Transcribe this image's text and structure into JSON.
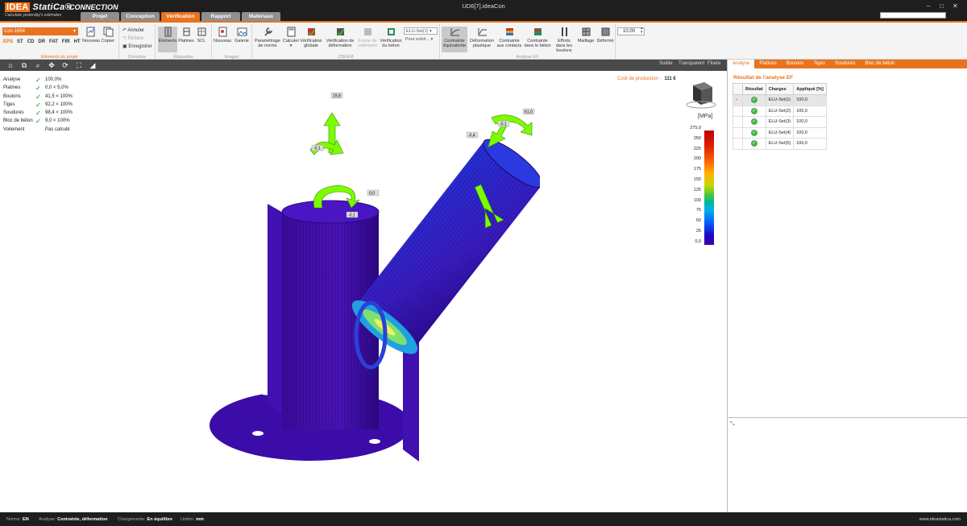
{
  "titlebar": {
    "logo_prefix": "IDEA",
    "logo_brand": "StatiCa®",
    "tagline": "Calculate yesterday's estimates",
    "product": "CONNECTION",
    "window_title": "UD6[7].ideaCon",
    "tabs": [
      "Projet",
      "Conception",
      "Vérification",
      "Rapport",
      "Matériaux"
    ],
    "active_tab": "Vérification",
    "controls": [
      "–",
      "□",
      "✕"
    ]
  },
  "ribbon": {
    "connection_select": "Con 1654",
    "member_types": [
      "EPS",
      "ST",
      "CD",
      "DR",
      "FAT",
      "FIR",
      "HT"
    ],
    "group_project_items": "Eléments du projet",
    "new_label": "Nouveau",
    "copy_label": "Copier",
    "undo_label": "Annuler",
    "redo_label": "Refaire",
    "save_label": "Enregistrer",
    "group_data": "Données",
    "elements_label": "Éléments",
    "plates_label": "Platines",
    "scl_label": "SCL",
    "group_labels": "Étiquettes",
    "img_new_label": "Nouveau",
    "gallery_label": "Galerie",
    "group_images": "Images",
    "code_setup_label": "Paramétrage de norme",
    "calculate_label": "Calculer",
    "global_check_label": "Vérification globale",
    "deform_check_label": "Vérification de déformation",
    "buckling_shape_label": "Forme de voilement",
    "concrete_check_label": "Vérification du béton",
    "group_cbfem": "CBFEM",
    "load_select": "ELU-Set(1)",
    "extreme_select": "Pour extrê...",
    "equiv_stress_label": "Contrainte équivalente",
    "plastic_strain_label": "Déformation plastique",
    "contact_stress_label": "Contrainte aux contacts",
    "concrete_stress_label": "Contrainte dans le béton",
    "bolt_forces_label": "Efforts dans les boulons",
    "mesh_label": "Maillage",
    "deformed_label": "Déformé",
    "group_fea": "Analyse EF",
    "scale_value": "10,00"
  },
  "viewbar": {
    "modes": [
      "Solide",
      "Transparent",
      "Filaire"
    ]
  },
  "results": [
    {
      "name": "Analyse",
      "value": "100,0%"
    },
    {
      "name": "Platines",
      "value": "0,0 < 5,0%"
    },
    {
      "name": "Boulons",
      "value": "41,5 < 100%"
    },
    {
      "name": "Tiges",
      "value": "92,2 < 100%"
    },
    {
      "name": "Soudures",
      "value": "98,4 < 100%"
    },
    {
      "name": "Bloc de béton",
      "value": "9,0 < 100%"
    },
    {
      "name": "Voilement",
      "value": "Pas calculé"
    }
  ],
  "production_cost": {
    "label": "Coût de production",
    "separator": "-",
    "value": "111 €"
  },
  "legend": {
    "unit": "[MPa]",
    "ticks": [
      "275,0",
      "250",
      "225",
      "200",
      "175",
      "150",
      "125",
      "100",
      "75",
      "50",
      "25",
      "0,0"
    ]
  },
  "model_tags": [
    "19,8",
    "-0,1",
    "0,0",
    "-0,1",
    "-0,4",
    "-0,1",
    "61,0"
  ],
  "right_panel": {
    "tabs": [
      "Analyse",
      "Platines",
      "Boulons",
      "Tiges",
      "Soudures",
      "Bloc de béton"
    ],
    "active_tab": "Analyse",
    "title": "Résultat de l'analyse EF",
    "columns": [
      "Résultat",
      "Charges",
      "Appliqué [%]"
    ],
    "rows": [
      {
        "charge": "ELU-Set(1)",
        "applied": "100,0"
      },
      {
        "charge": "ELU-Set(2)",
        "applied": "100,0"
      },
      {
        "charge": "ELU-Set(3)",
        "applied": "100,0"
      },
      {
        "charge": "ELU-Set(4)",
        "applied": "100,0"
      },
      {
        "charge": "ELU-Set(5)",
        "applied": "100,0"
      }
    ],
    "row_marker": "›",
    "expand_icon": "⤡"
  },
  "statusbar": {
    "norm_label": "Norme:",
    "norm_value": "EN",
    "analysis_label": "Analyse:",
    "analysis_value": "Contrainte, déformation",
    "loads_label": "Chargements:",
    "loads_value": "En équilibre",
    "units_label": "Unités:",
    "units_value": "mm",
    "url": "www.ideastatica.com"
  },
  "colors": {
    "accent": "#e8731e",
    "ok": "#4caf50",
    "dark": "#1e1e1e",
    "model_base": "#3a0ea0",
    "arrow": "#7cfc00"
  }
}
